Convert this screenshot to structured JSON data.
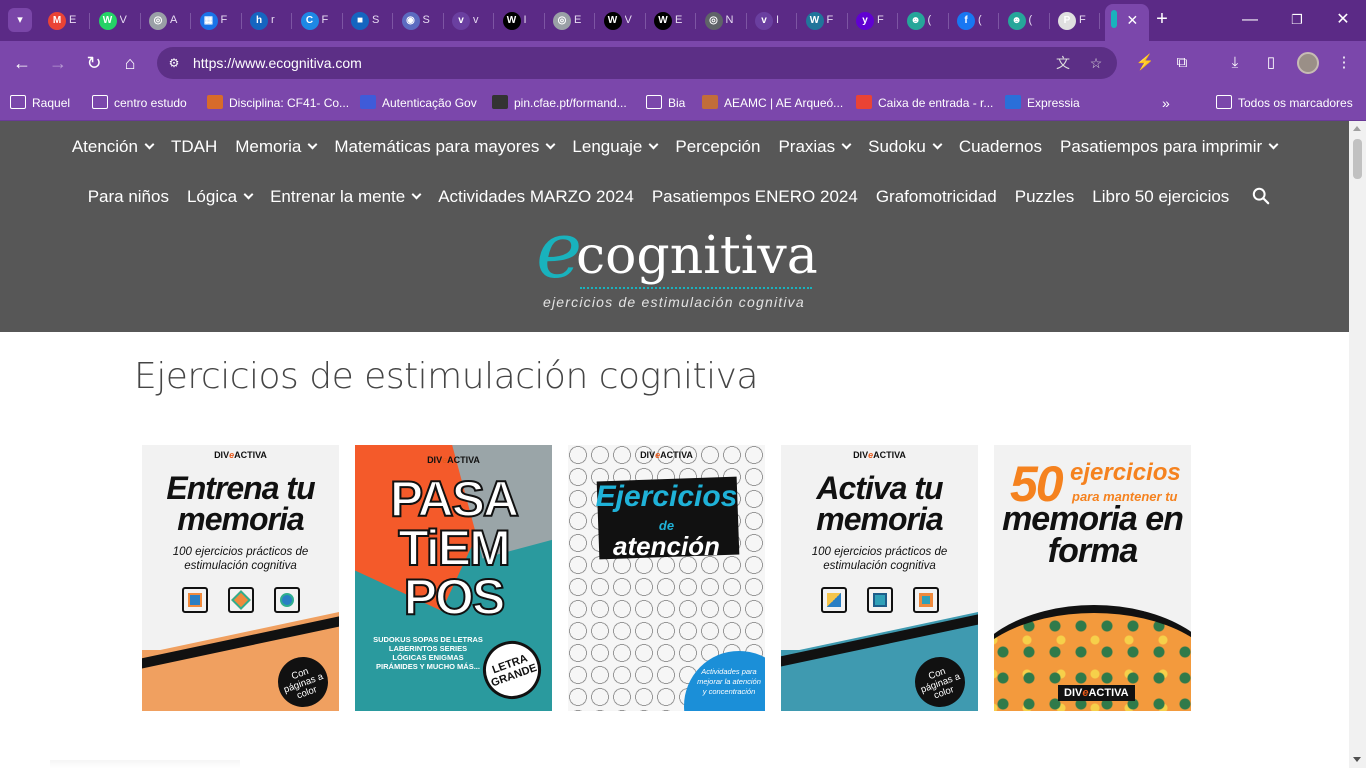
{
  "browser": {
    "tabs": [
      {
        "icon": "gmail-icon",
        "letter": "M",
        "color": "#ea4335",
        "title": "E"
      },
      {
        "icon": "whatsapp-icon",
        "letter": "W",
        "color": "#25d366",
        "title": "V"
      },
      {
        "icon": "app-icon",
        "letter": "◎",
        "color": "#9aa0a6",
        "title": "A"
      },
      {
        "icon": "app-icon",
        "letter": "▦",
        "color": "#1a73e8",
        "title": "F"
      },
      {
        "icon": "app-icon",
        "letter": "h",
        "color": "#1565c0",
        "title": "r"
      },
      {
        "icon": "app-icon",
        "letter": "C",
        "color": "#1e88e5",
        "title": "F"
      },
      {
        "icon": "app-icon",
        "letter": "■",
        "color": "#1565c0",
        "title": "S"
      },
      {
        "icon": "app-icon",
        "letter": "◉",
        "color": "#5c6bc0",
        "title": "S"
      },
      {
        "icon": "app-icon",
        "letter": "v",
        "color": "#6a3fa0",
        "title": "v"
      },
      {
        "icon": "wix-icon",
        "letter": "W",
        "color": "#000000",
        "title": "I"
      },
      {
        "icon": "app-icon",
        "letter": "◎",
        "color": "#9aa0a6",
        "title": "E"
      },
      {
        "icon": "wix-icon",
        "letter": "W",
        "color": "#000000",
        "title": "V"
      },
      {
        "icon": "wix-icon",
        "letter": "W",
        "color": "#000000",
        "title": "E"
      },
      {
        "icon": "app-icon",
        "letter": "◎",
        "color": "#5f6368",
        "title": "N"
      },
      {
        "icon": "app-icon",
        "letter": "v",
        "color": "#6a3fa0",
        "title": "I"
      },
      {
        "icon": "wordpress-icon",
        "letter": "W",
        "color": "#21759b",
        "title": "F"
      },
      {
        "icon": "yahoo-icon",
        "letter": "y",
        "color": "#6001d2",
        "title": "F"
      },
      {
        "icon": "app-icon",
        "letter": "☻",
        "color": "#26a69a",
        "title": "("
      },
      {
        "icon": "facebook-icon",
        "letter": "f",
        "color": "#1877f2",
        "title": "("
      },
      {
        "icon": "app-icon",
        "letter": "☻",
        "color": "#26a69a",
        "title": "("
      },
      {
        "icon": "app-icon",
        "letter": "P",
        "color": "#e0e0e0",
        "title": "F"
      }
    ],
    "url": "https://www.ecognitiva.com",
    "bookmarks": [
      {
        "label": "Raquel",
        "type": "folder"
      },
      {
        "label": "centro estudo",
        "type": "folder"
      },
      {
        "label": "Disciplina: CF41- Co...",
        "type": "link"
      },
      {
        "label": "Autenticação Gov",
        "type": "link"
      },
      {
        "label": "pin.cfae.pt/formand...",
        "type": "link"
      },
      {
        "label": "Bia",
        "type": "folder"
      },
      {
        "label": "AEAMC | AE Arqueó...",
        "type": "link"
      },
      {
        "label": "Caixa de entrada - r...",
        "type": "link"
      },
      {
        "label": "Expressia",
        "type": "link"
      }
    ],
    "all_bookmarks_label": "Todos os marcadores"
  },
  "site": {
    "menu_row1": [
      {
        "label": "Atención",
        "dropdown": true
      },
      {
        "label": "TDAH",
        "dropdown": false
      },
      {
        "label": "Memoria",
        "dropdown": true
      },
      {
        "label": "Matemáticas para mayores",
        "dropdown": true
      },
      {
        "label": "Lenguaje",
        "dropdown": true
      },
      {
        "label": "Percepción",
        "dropdown": false
      },
      {
        "label": "Praxias",
        "dropdown": true
      },
      {
        "label": "Sudoku",
        "dropdown": true
      },
      {
        "label": "Cuadernos",
        "dropdown": false
      },
      {
        "label": "Pasatiempos para imprimir",
        "dropdown": true
      }
    ],
    "menu_row2": [
      {
        "label": "Para niños",
        "dropdown": false
      },
      {
        "label": "Lógica",
        "dropdown": true
      },
      {
        "label": "Entrenar la mente",
        "dropdown": true
      },
      {
        "label": "Actividades MARZO 2024",
        "dropdown": false
      },
      {
        "label": "Pasatiempos ENERO 2024",
        "dropdown": false
      },
      {
        "label": "Grafomotricidad",
        "dropdown": false
      },
      {
        "label": "Puzzles",
        "dropdown": false
      },
      {
        "label": "Libro 50 ejercicios",
        "dropdown": false
      }
    ],
    "logo": {
      "initial": "e",
      "word": "cognitiva",
      "tagline": "ejercicios de estimulación cognitiva",
      "accent": "#19b2bd"
    },
    "page_title": "Ejercicios de estimulación cognitiva",
    "books": {
      "publisher_pre": "DIV",
      "publisher_mid": "e",
      "publisher_post": "ACTIVA",
      "b1": {
        "title": "Entrena tu memoria",
        "subtitle": "100 ejercicios prácticos de estimulación cognitiva",
        "badge": "Con páginas a color"
      },
      "b2": {
        "title_a": "PASA",
        "title_b": "TiEM",
        "title_c": "POS",
        "list": "SUDOKUS SOPAS DE LETRAS LABERINTOS SERIES LÓGICAS ENIGMAS PIRÁMIDES Y MUCHO MÁS...",
        "badge": "LETRA GRANDE"
      },
      "b3": {
        "title_a": "Ejercicios",
        "title_b": "de",
        "title_c": "atención",
        "note": "Actividades para mejorar la atención y concentración"
      },
      "b4": {
        "title": "Activa tu memoria",
        "subtitle": "100 ejercicios prácticos de estimulación cognitiva",
        "badge": "Con páginas a color"
      },
      "b5": {
        "number": "50",
        "word": "ejercicios",
        "para": "para mantener tu",
        "title": "memoria en forma"
      }
    }
  }
}
